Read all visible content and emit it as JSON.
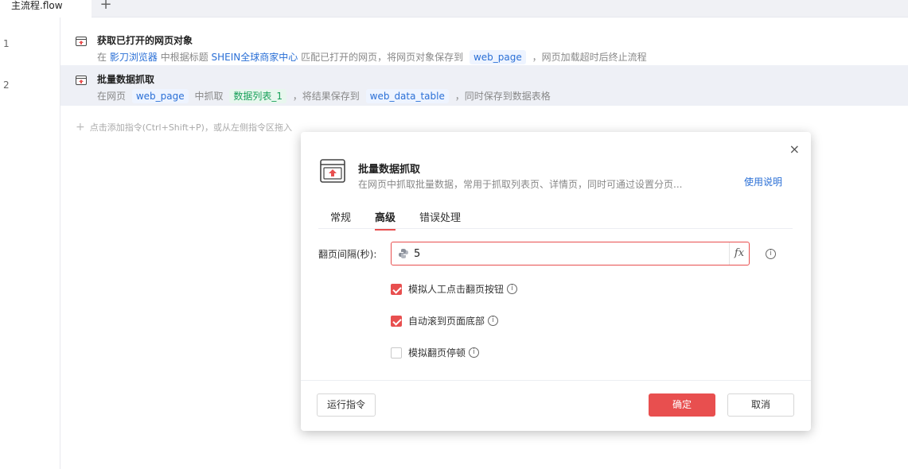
{
  "tab": {
    "name": "主流程.flow",
    "add": "+"
  },
  "lines": [
    "1",
    "2"
  ],
  "steps": [
    {
      "title": "获取已打开的网页对象",
      "desc": {
        "p1": "在",
        "browser": "影刀浏览器",
        "p2": "中根据标题",
        "page_title": "SHEIN全球商家中心",
        "p3": "匹配已打开的网页，将网页对象保存到",
        "var": "web_page",
        "p4": "，网页加载超时后终止流程"
      }
    },
    {
      "title": "批量数据抓取",
      "desc": {
        "p1": "在网页",
        "var": "web_page",
        "p2": "中抓取",
        "list": "数据列表_1",
        "p3": "，将结果保存到",
        "table": "web_data_table",
        "p4": "，同时保存到数据表格"
      }
    }
  ],
  "add_hint": "点击添加指令(Ctrl+Shift+P)，或从左侧指令区拖入",
  "dialog": {
    "close": "×",
    "title": "批量数据抓取",
    "desc": "在网页中抓取批量数据，常用于抓取列表页、详情页，同时可通过设置分页...",
    "help": "使用说明",
    "tabs": [
      "常规",
      "高级",
      "错误处理"
    ],
    "active_tab": "高级",
    "interval_label": "翻页间隔(秒):",
    "interval_value": "5",
    "fx": "fx",
    "info": "i",
    "checks": [
      {
        "label": "模拟人工点击翻页按钮",
        "checked": true
      },
      {
        "label": "自动滚到页面底部",
        "checked": true
      },
      {
        "label": "模拟翻页停顿",
        "checked": false
      }
    ],
    "run_btn": "运行指令",
    "ok_btn": "确定",
    "cancel_btn": "取消"
  },
  "colors": {
    "accent": "#e84f4f",
    "link": "#2a6fd6",
    "tag_green": "#19a05a"
  },
  "icons": {
    "step": "browser-window-icon",
    "python": "python-icon",
    "info": "info-icon",
    "close": "close-icon"
  }
}
